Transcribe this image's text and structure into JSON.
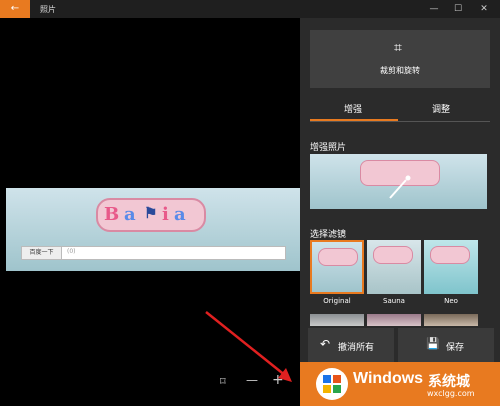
{
  "titlebar": {
    "back_glyph": "←",
    "title": "照片",
    "minimize": "—",
    "maximize": "☐",
    "close": "✕"
  },
  "photo": {
    "search_button": "百度一下",
    "search_placeholder": "(0)"
  },
  "bottom_tools": {
    "fit_glyph": "⌑",
    "zoom_out": "—",
    "zoom_in": "+"
  },
  "panel": {
    "crop_icon": "⌗",
    "crop_label": "裁剪和旋转",
    "tabs": [
      {
        "label": "增强"
      },
      {
        "label": "调整"
      }
    ],
    "enhance_title": "增强照片",
    "filters_title": "选择滤镜",
    "filters": [
      {
        "label": "Original"
      },
      {
        "label": "Sauna"
      },
      {
        "label": "Neo"
      }
    ],
    "undo_icon": "↶",
    "undo_label": "撤消所有",
    "save_icon": "💾",
    "save_label": "保存"
  },
  "watermark": {
    "brand": "Windows",
    "suffix": "系统城",
    "url": "wxclgg.com"
  },
  "colors": {
    "accent": "#e87a20",
    "panel": "#2b2b2b",
    "card": "#404040"
  }
}
